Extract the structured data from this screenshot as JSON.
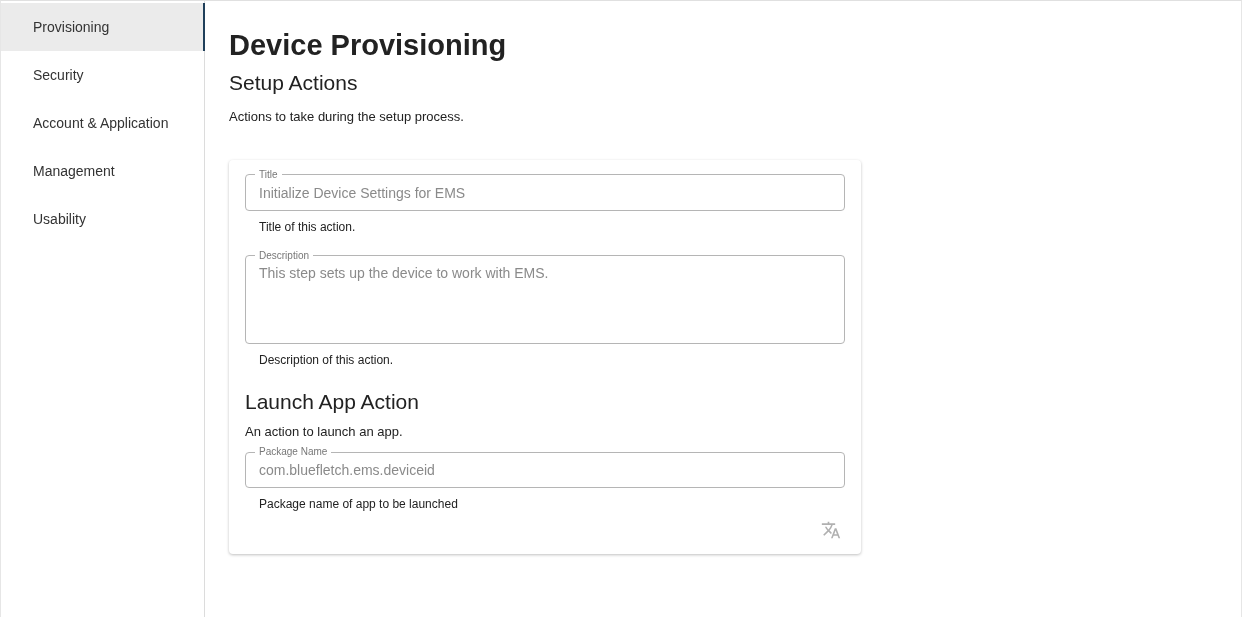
{
  "sidebar": {
    "items": [
      {
        "label": "Provisioning",
        "selected": true
      },
      {
        "label": "Security",
        "selected": false
      },
      {
        "label": "Account & Application",
        "selected": false
      },
      {
        "label": "Management",
        "selected": false
      },
      {
        "label": "Usability",
        "selected": false
      }
    ]
  },
  "page": {
    "title": "Device Provisioning",
    "section_title": "Setup Actions",
    "section_description": "Actions to take during the setup process."
  },
  "card": {
    "fields": [
      {
        "kind": "text",
        "label": "Title",
        "placeholder": "Initialize Device Settings for EMS",
        "help": "Title of this action."
      },
      {
        "kind": "multiline",
        "label": "Description",
        "placeholder": "This step sets up the device to work with EMS.",
        "help": "Description of this action."
      }
    ],
    "subsection": {
      "title": "Launch App Action",
      "description": "An action to launch an app.",
      "fields": [
        {
          "kind": "text",
          "label": "Package Name",
          "placeholder": "com.bluefletch.ems.deviceid",
          "help": "Package name of app to be launched"
        }
      ]
    }
  }
}
